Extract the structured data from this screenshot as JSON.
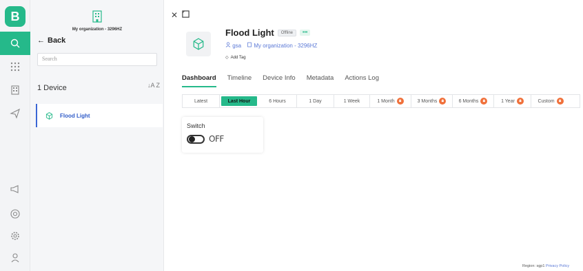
{
  "rail": {
    "logo": "B"
  },
  "org": {
    "name": "My organization - 3296HZ"
  },
  "nav": {
    "back": "Back"
  },
  "search": {
    "placeholder": "Search"
  },
  "list": {
    "count": "1 Device",
    "sort": "↓A Z",
    "items": [
      {
        "name": "Flood Light"
      }
    ]
  },
  "device": {
    "name": "Flood Light",
    "status": "Offline",
    "more": "•••",
    "owner": "gsa",
    "org": "My organization - 3296HZ",
    "add_tag": "Add Tag"
  },
  "tabs": [
    "Dashboard",
    "Timeline",
    "Device Info",
    "Metadata",
    "Actions Log"
  ],
  "ranges": [
    {
      "label": "Latest"
    },
    {
      "label": "Last Hour"
    },
    {
      "label": "6 Hours"
    },
    {
      "label": "1 Day"
    },
    {
      "label": "1 Week"
    },
    {
      "label": "1 Month",
      "locked": true
    },
    {
      "label": "3 Months",
      "locked": true
    },
    {
      "label": "6 Months",
      "locked": true
    },
    {
      "label": "1 Year",
      "locked": true
    },
    {
      "label": "Custom",
      "locked": true
    }
  ],
  "widget": {
    "title": "Switch",
    "state": "OFF"
  },
  "footer": {
    "region": "Region: sgp1",
    "privacy": "Privacy Policy"
  },
  "colors": {
    "accent": "#25b98a",
    "link": "#5a78d6",
    "lock": "#f0703a"
  }
}
